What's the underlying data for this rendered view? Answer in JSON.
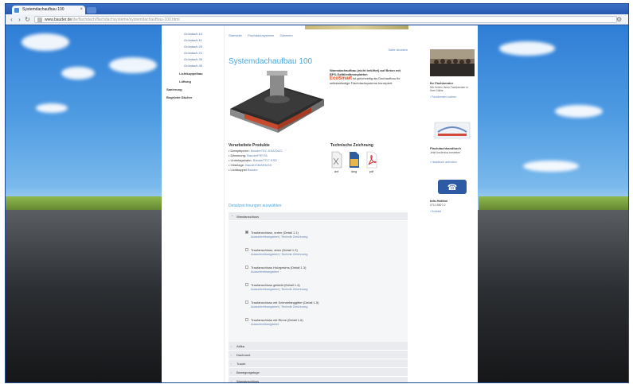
{
  "browser": {
    "tab_title": "Systemdachaufbau 100",
    "url_host": "www.bauder.de",
    "url_path": "/de/flachdach/flachdachsysteme/systemdachaufbau-100.html"
  },
  "leftnav": {
    "items": [
      {
        "label": "Gründach 10"
      },
      {
        "label": "Gründach 11"
      },
      {
        "label": "Gründach 20"
      },
      {
        "label": "Gründach 21"
      },
      {
        "label": "Gründach 30"
      },
      {
        "label": "Gründach 40"
      },
      {
        "label": "Lichtkuppelbau"
      },
      {
        "label": "Lüftung"
      },
      {
        "label": "Sanierung"
      },
      {
        "label": "Begrünte Dächer"
      }
    ]
  },
  "content": {
    "breadcrumb": [
      "Startseite",
      "Flachdachsysteme",
      "Dämmen"
    ],
    "print_label": "Seite drucken",
    "title": "Systemdachaufbau 100",
    "desc_bold": "Warmdachaufbau (nicht belüftet) auf Beton mit EPS-Gefälledämmplatten",
    "eco_label": "EcoSmart",
    "desc_text": "ist gleichzeitig als Dachaufbau für selbstständige Flachdachsysteme konzipiert.",
    "products_heading": "Verarbeitete Produkte",
    "products": [
      {
        "label": "Dampfsperre:",
        "link": "BauderTEC KSA DUO"
      },
      {
        "label": "Dämmung:",
        "link": "BauderPIR FA"
      },
      {
        "label": "Unterlagsbahn:",
        "link": "BauderTEC KSD"
      },
      {
        "label": "Oberlage:",
        "link": "BauderSMARAGD"
      },
      {
        "label": "Lichtkuppel",
        "link": "Bauder"
      }
    ],
    "drawing_heading": "Technische Zeichnung",
    "drawings": [
      {
        "format": "dxf",
        "icon": "dxf-file-icon"
      },
      {
        "format": "dwg",
        "icon": "dwg-file-icon"
      },
      {
        "format": "pdf",
        "icon": "pdf-file-icon"
      }
    ],
    "variants_heading": "Detailzeichnungen auswählen",
    "accordion": [
      {
        "label": "Wandanschluss",
        "open": true
      },
      {
        "label": "Attika",
        "open": false
      },
      {
        "label": "Dachrand",
        "open": false
      },
      {
        "label": "Traufe",
        "open": false
      },
      {
        "label": "Bewegungsfuge",
        "open": false
      },
      {
        "label": "Wandanschluss",
        "open": false
      }
    ],
    "variants": [
      {
        "title": "Traufanschluss, unten (Detail 1.1)",
        "links": "Ausschreibungstext | Technik Zeichnung"
      },
      {
        "title": "Traufanschluss, oben (Detail 1.2)",
        "links": "Ausschreibungstext | Technik Zeichnung"
      },
      {
        "title": "Traufanschluss Holzgesims (Detail 1.3)",
        "links": "Ausschreibungstext"
      },
      {
        "title": "Traufanschluss geklebt (Detail 1.4)",
        "links": "Ausschreibungstext | Technik Zeichnung"
      },
      {
        "title": "Traufanschluss mit Schneefanggitter (Detail 1.5)",
        "links": "Ausschreibungstext | Technik Zeichnung"
      },
      {
        "title": "Traufanschluss mit Rinne (Detail 1.6)",
        "links": "Ausschreibungstext"
      }
    ]
  },
  "rightcol": {
    "box1_title": "Ihr Fachberater",
    "box1_text": "Wir finden Ihren Fachberater in Ihrer Nähe",
    "box1_link": "› Fachberater suchen",
    "box2_title": "Flachdachhandbuch",
    "box2_text": "Jetzt kostenlos bestellen",
    "box2_link": "› Handbuch anfordern",
    "box3_title": "Info-Hotline",
    "box3_text": "0711 8807-0",
    "box3_link": "› Kontakt"
  }
}
